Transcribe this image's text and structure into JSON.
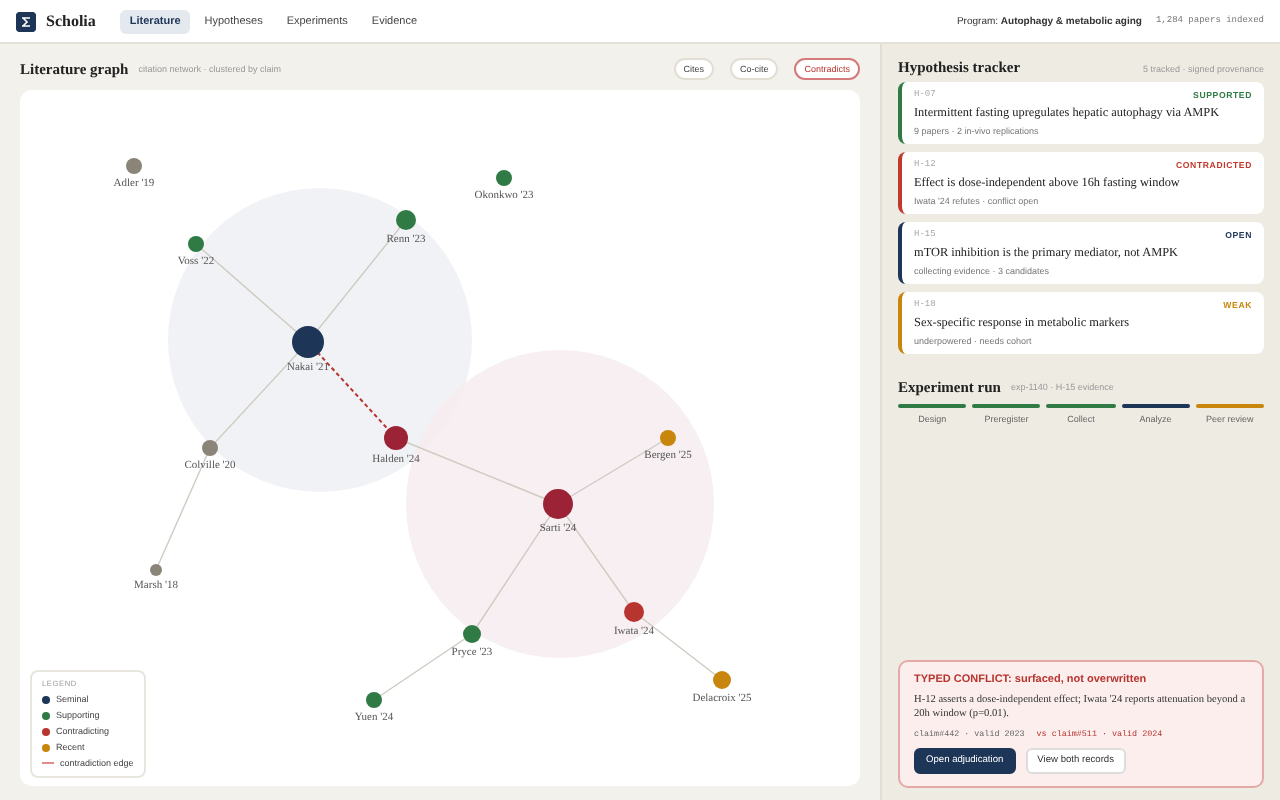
{
  "app": {
    "name": "Scholia"
  },
  "tabs": [
    {
      "label": "Literature",
      "selected": true
    },
    {
      "label": "Hypotheses",
      "selected": false
    },
    {
      "label": "Experiments",
      "selected": false
    },
    {
      "label": "Evidence",
      "selected": false
    }
  ],
  "program": {
    "label": "Program:",
    "value": "Autophagy & metabolic aging",
    "count": "1,284 papers indexed"
  },
  "graph": {
    "title": "Literature graph",
    "subtitle": "citation network · clustered by claim",
    "filters": [
      {
        "label": "Cites",
        "selected": false
      },
      {
        "label": "Co-cite",
        "selected": false
      },
      {
        "label": "Contradicts",
        "selected": true
      }
    ],
    "nodes": [
      {
        "label": "Adler '19",
        "color": "#8a8578"
      },
      {
        "label": "Okonkwo '23",
        "color": "#2f7a45"
      },
      {
        "label": "Voss '22",
        "color": "#2f7a45"
      },
      {
        "label": "Renn '23",
        "color": "#2f7a45"
      },
      {
        "label": "Nakai '21",
        "color": "#1d3557"
      },
      {
        "label": "Halden '24",
        "color": "#9b2335"
      },
      {
        "label": "Colville '20",
        "color": "#8a8578"
      },
      {
        "label": "Bergen '25",
        "color": "#c8860d"
      },
      {
        "label": "Sarti '24",
        "color": "#9b2335"
      },
      {
        "label": "Marsh '18",
        "color": "#8a8578"
      },
      {
        "label": "Iwata '24",
        "color": "#b8342f"
      },
      {
        "label": "Pryce '23",
        "color": "#2f7a45"
      },
      {
        "label": "Yuen '24",
        "color": "#2f7a45"
      },
      {
        "label": "Delacroix '25",
        "color": "#c8860d"
      }
    ],
    "legend": {
      "title": "LEGEND",
      "items": [
        {
          "label": "Seminal",
          "kind": "dot",
          "color": "#1d3557"
        },
        {
          "label": "Supporting",
          "kind": "dot",
          "color": "#2f7a45"
        },
        {
          "label": "Contradicting",
          "kind": "dot",
          "color": "#b8342f"
        },
        {
          "label": "Recent",
          "kind": "dot",
          "color": "#c8860d"
        },
        {
          "label": "contradiction edge",
          "kind": "line",
          "color": "#e08a8a"
        }
      ]
    }
  },
  "tracker": {
    "title": "Hypothesis tracker",
    "subtitle": "5 tracked · signed provenance",
    "cards": [
      {
        "id": "H-07",
        "status": "SUPPORTED",
        "color": "#2f7a45",
        "title": "Intermittent fasting upregulates hepatic autophagy via AMPK",
        "meta": "9 papers · 2 in-vivo replications"
      },
      {
        "id": "H-12",
        "status": "CONTRADICTED",
        "color": "#c0392b",
        "title": "Effect is dose-independent above 16h fasting window",
        "meta": "Iwata '24 refutes · conflict open"
      },
      {
        "id": "H-15",
        "status": "OPEN",
        "color": "#1d3557",
        "title": "mTOR inhibition is the primary mediator, not AMPK",
        "meta": "collecting evidence · 3 candidates"
      },
      {
        "id": "H-18",
        "status": "WEAK",
        "color": "#c8860d",
        "title": "Sex-specific response in metabolic markers",
        "meta": "underpowered · needs cohort"
      }
    ]
  },
  "experiment": {
    "title": "Experiment run",
    "subtitle": "exp-1140 · H-15 evidence",
    "steps": [
      {
        "label": "Design",
        "color": "#2f7a45"
      },
      {
        "label": "Preregister",
        "color": "#2f7a45"
      },
      {
        "label": "Collect",
        "color": "#2f7a45"
      },
      {
        "label": "Analyze",
        "color": "#1d3557"
      },
      {
        "label": "Peer review",
        "color": "#c8860d"
      }
    ]
  },
  "conflict": {
    "title": "TYPED CONFLICT: surfaced, not overwritten",
    "body": "H-12 asserts a dose-independent effect; Iwata '24 reports attenuation beyond a 20h window (p=0.01).",
    "claim_a": "claim#442 · valid 2023",
    "claim_b": "vs claim#511 · valid 2024",
    "buttons": [
      {
        "label": "Open adjudication",
        "kind": "primary"
      },
      {
        "label": "View both records",
        "kind": "secondary"
      }
    ]
  }
}
